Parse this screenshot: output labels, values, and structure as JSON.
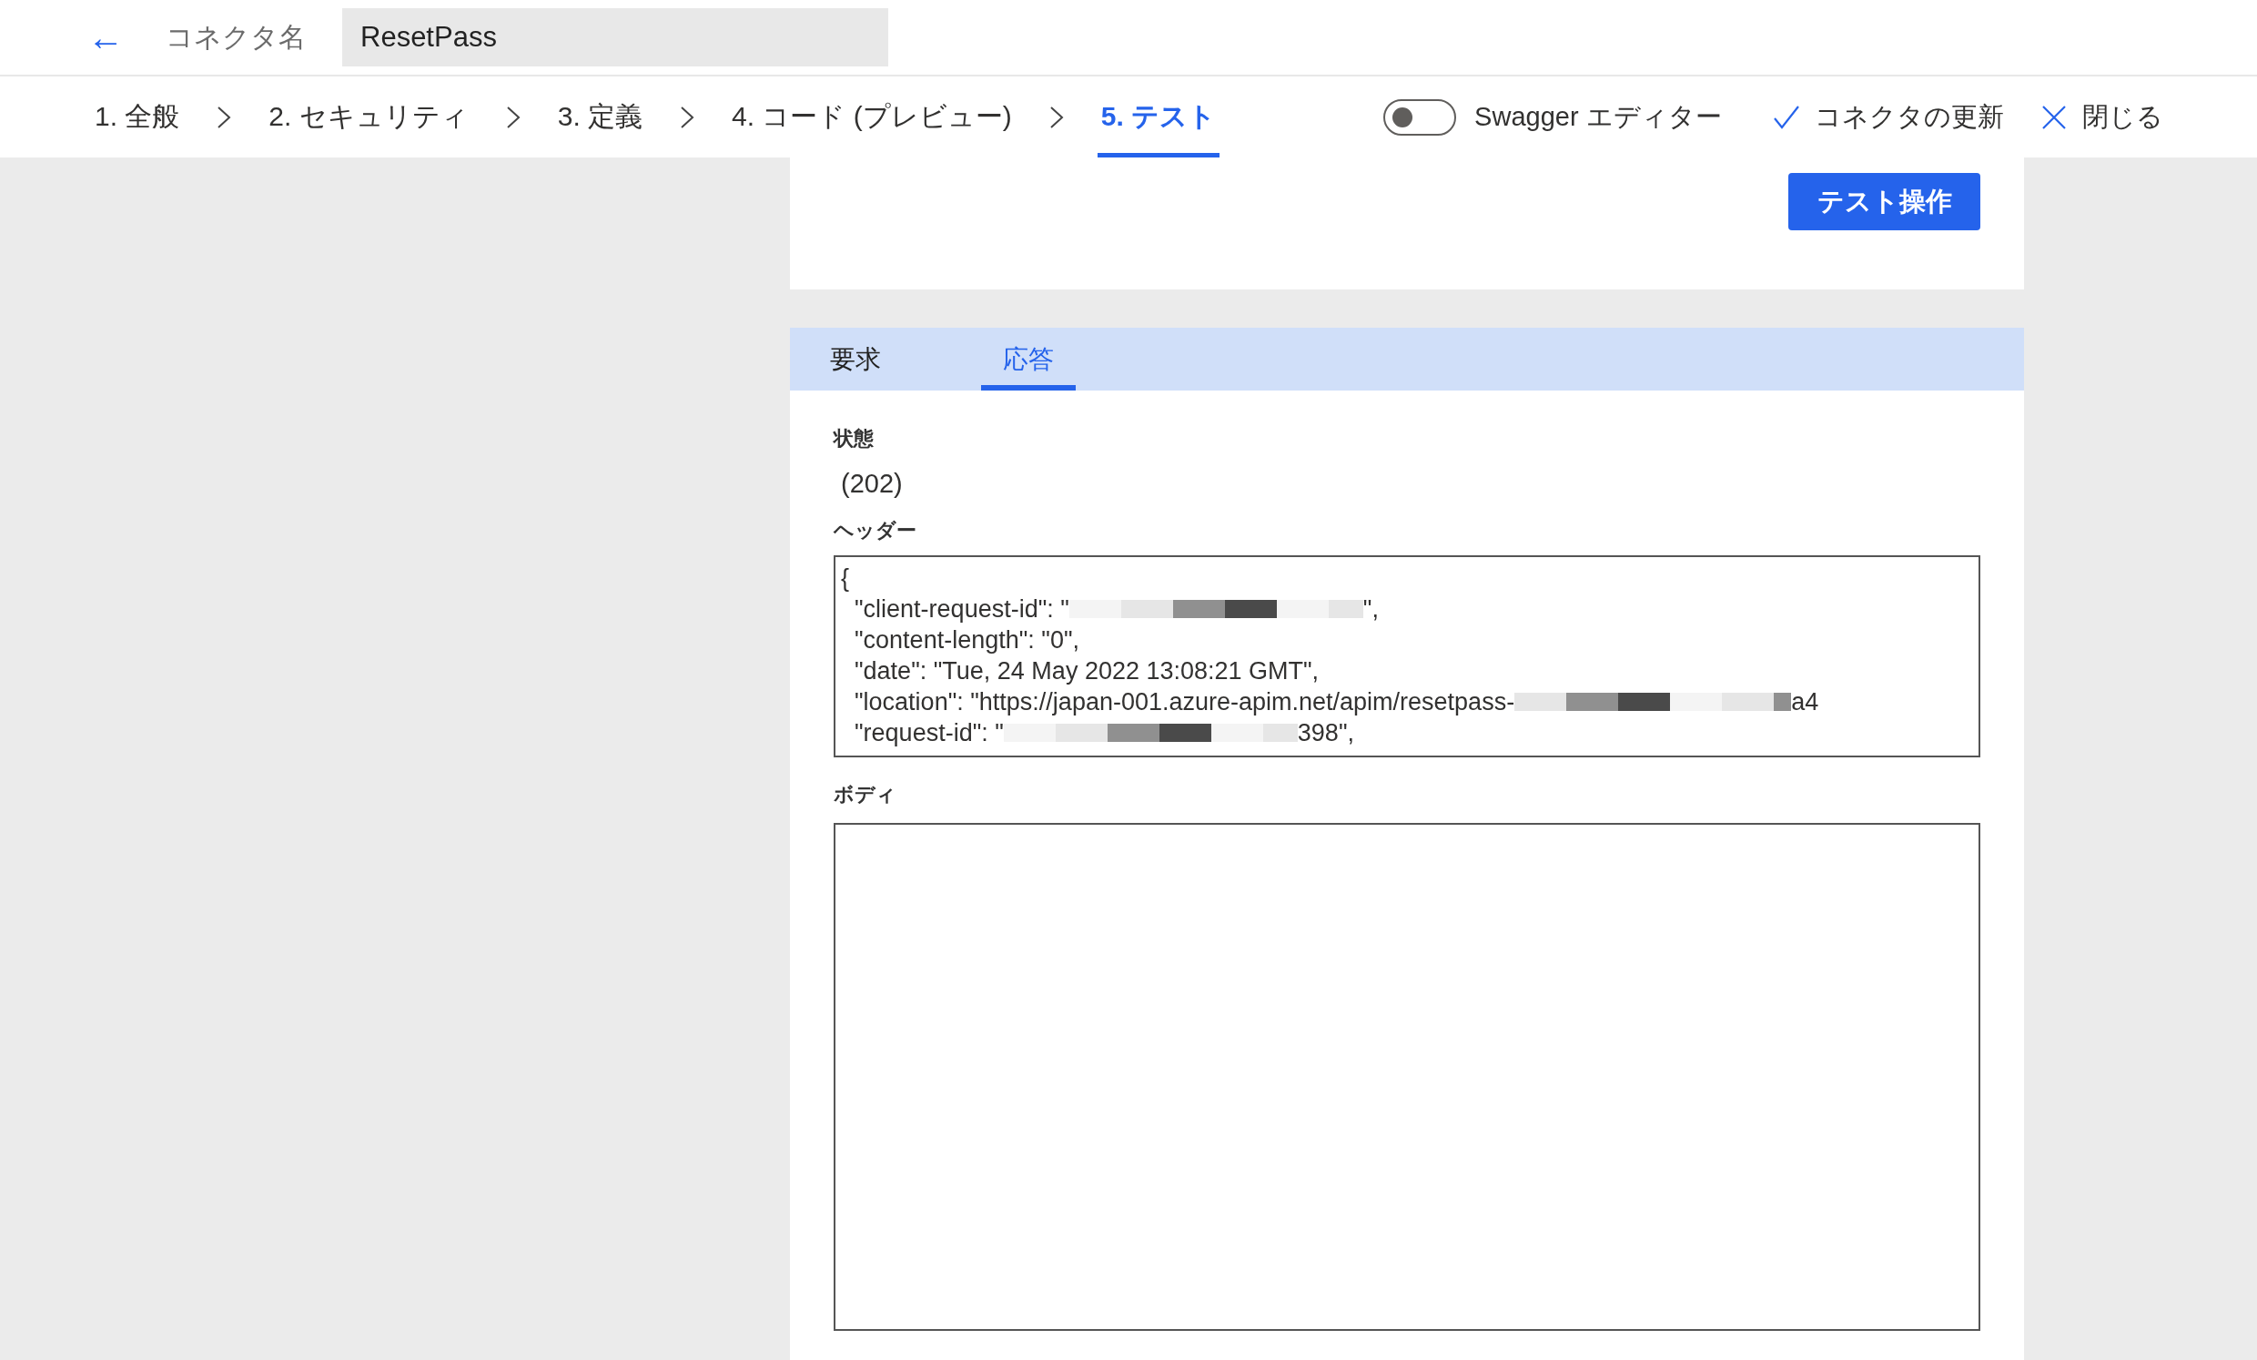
{
  "top_bar": {
    "back_label": "←",
    "connector_label": "コネクタ名",
    "connector_name": "ResetPass"
  },
  "steps": [
    {
      "label": "1. 全般",
      "selected": false
    },
    {
      "label": "2. セキュリティ",
      "selected": false
    },
    {
      "label": "3. 定義",
      "selected": false
    },
    {
      "label": "4. コード (プレビュー)",
      "selected": false
    },
    {
      "label": "5. テスト",
      "selected": true
    }
  ],
  "swagger_toggle": {
    "label": "Swagger エディター",
    "on": false
  },
  "actions": [
    {
      "kind": "check",
      "label": "コネクタの更新"
    },
    {
      "kind": "close",
      "label": "閉じる"
    }
  ],
  "test_button": "テスト操作",
  "response_tabs": [
    {
      "label": "要求",
      "selected": false
    },
    {
      "label": "応答",
      "selected": true
    }
  ],
  "status": {
    "label": "状態",
    "value": "(202)"
  },
  "headers": {
    "label": "ヘッダー",
    "lines": [
      {
        "prefix": "{",
        "redacted": false
      },
      {
        "prefix": "  \"client-request-id\": \"",
        "redacted": true,
        "suffix": "\","
      },
      {
        "prefix": "  \"content-length\": \"0\",",
        "redacted": false
      },
      {
        "prefix": "  \"date\": \"Tue, 24 May 2022 13:08:21 GMT\",",
        "redacted": false
      },
      {
        "prefix": "  \"location\": \"https://japan-001.azure-apim.net/apim/resetpass-",
        "redacted": true,
        "suffix": "a4"
      },
      {
        "prefix": "  \"request-id\": \"",
        "redacted": true,
        "suffix": "398\","
      }
    ]
  },
  "body": {
    "label": "ボディ"
  }
}
